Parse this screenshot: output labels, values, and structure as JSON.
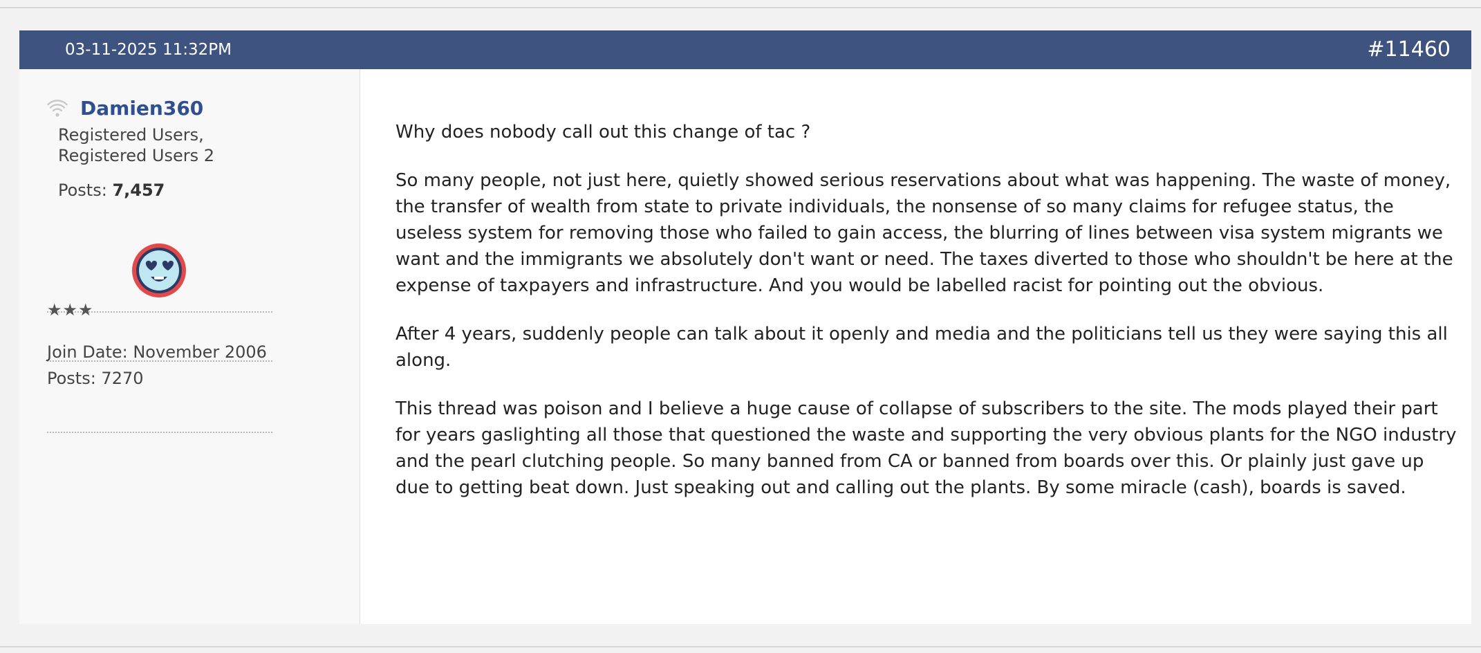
{
  "post": {
    "date": "03-11-2025 11:32PM",
    "number": "#11460",
    "header_color": "#3e5380"
  },
  "user": {
    "name": "Damien360",
    "groups": [
      "Registered Users,",
      "Registered Users 2"
    ],
    "posts_label": "Posts:",
    "posts_value": "7,457",
    "rank": "★★★",
    "join_date": "Join Date: November 2006",
    "post_count": "Posts: 7270",
    "name_color": "#2f4f90",
    "status_icon": "wifi-status-icon",
    "avatar_icon": "heart-eyes-emoji-icon"
  },
  "message": {
    "paragraphs": [
      "Why does nobody call out this change of tac ?",
      "So many people, not just here, quietly showed serious reservations about what was happening. The waste of money, the transfer of wealth from state to private individuals, the nonsense of so many claims for refugee status, the useless system for removing those who failed to gain access, the blurring of lines between visa system migrants we want and the immigrants we absolutely don't want or need. The taxes diverted to those who shouldn't be here at the expense of taxpayers and infrastructure. And you would be labelled racist for pointing out the obvious.",
      "After 4 years, suddenly people can talk about it openly and media and the politicians tell us they were saying this all along.",
      "This thread was poison and I believe a huge cause of collapse of subscribers to the site. The mods played their part for years gaslighting all those that questioned the waste and supporting the very obvious plants for the NGO industry and the pearl clutching people. So many banned from CA or banned from boards over this. Or plainly just gave up due to getting beat down. Just speaking out and calling out the plants. By some miracle (cash), boards is saved."
    ]
  }
}
